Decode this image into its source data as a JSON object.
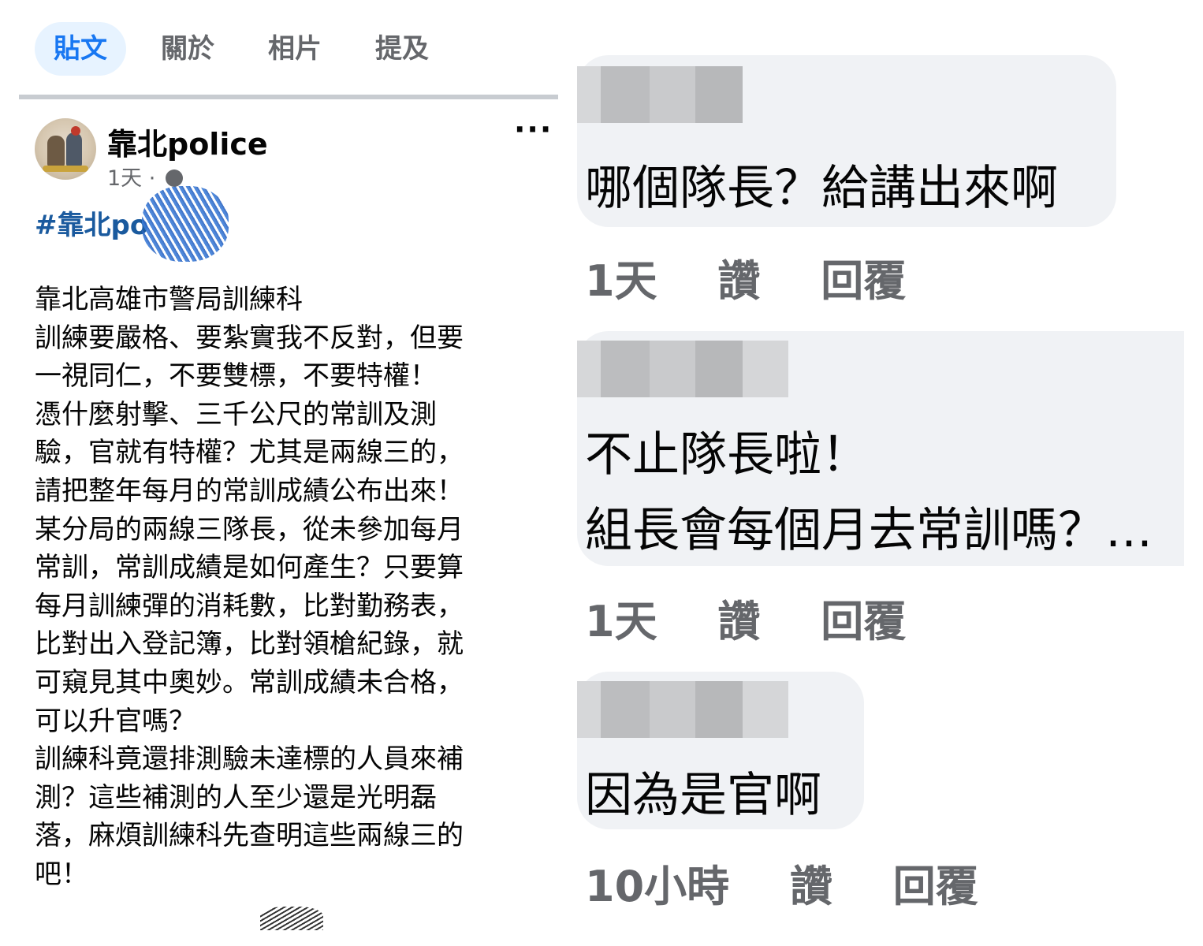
{
  "tabs": [
    {
      "label": "貼文",
      "active": true
    },
    {
      "label": "關於",
      "active": false
    },
    {
      "label": "相片",
      "active": false
    },
    {
      "label": "提及",
      "active": false
    }
  ],
  "post": {
    "page_name": "靠北police",
    "time": "1天",
    "separator": "·",
    "privacy_icon": "globe-icon",
    "more_label": "···",
    "hashtag": "#靠北po",
    "body": "靠北高雄市警局訓練科\n訓練要嚴格、要紮實我不反對，但要\n一視同仁，不要雙標，不要特權！\n憑什麼射擊、三千公尺的常訓及測\n驗，官就有特權？尤其是兩線三的，\n請把整年每月的常訓成績公布出來！\n某分局的兩線三隊長，從未參加每月\n常訓，常訓成績是如何產生？只要算\n每月訓練彈的消耗數，比對勤務表，\n比對出入登記簿，比對領槍紀錄，就\n可窺見其中奧妙。常訓成績未合格，\n可以升官嗎？\n訓練科竟還排測驗未達標的人員來補\n測？這些補測的人至少還是光明磊\n落，麻煩訓練科先查明這些兩線三的\n吧！"
  },
  "comments": [
    {
      "lines": [
        "哪個隊長？給講出來啊"
      ],
      "time": "1天",
      "like": "讚",
      "reply": "回覆"
    },
    {
      "lines": [
        "不止隊長啦！",
        "組長會每個月去常訓嗎？…"
      ],
      "time": "1天",
      "like": "讚",
      "reply": "回覆"
    },
    {
      "lines": [
        "因為是官啊"
      ],
      "time": "10小時",
      "like": "讚",
      "reply": "回覆"
    }
  ],
  "colors": {
    "accent": "#1877f2",
    "bubble": "#f0f2f5",
    "muted": "#65676b"
  }
}
